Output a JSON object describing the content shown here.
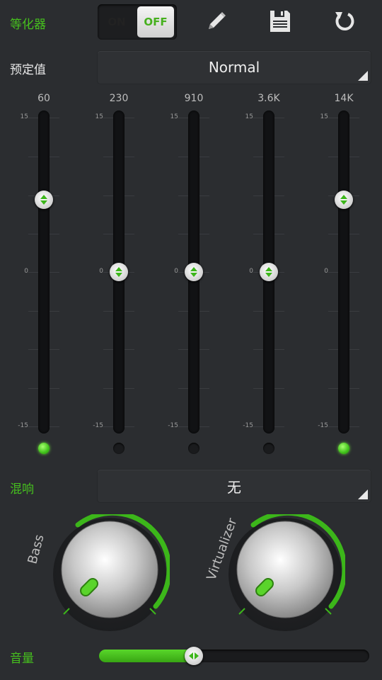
{
  "equalizer": {
    "label": "等化器",
    "toggle": {
      "on_label": "ON",
      "off_label": "OFF",
      "selected": "OFF"
    },
    "icons": [
      "pencil-icon",
      "save-icon",
      "reset-icon"
    ]
  },
  "preset": {
    "label": "预定值",
    "value": "Normal"
  },
  "scale": {
    "max": "15",
    "mid": "0",
    "min": "-15"
  },
  "bands": [
    {
      "freq": "60",
      "level": 7,
      "enabled": true
    },
    {
      "freq": "230",
      "level": 0,
      "enabled": false
    },
    {
      "freq": "910",
      "level": 0,
      "enabled": false
    },
    {
      "freq": "3.6K",
      "level": 0,
      "enabled": false
    },
    {
      "freq": "14K",
      "level": 7,
      "enabled": true
    }
  ],
  "reverb": {
    "label": "混响",
    "value": "无"
  },
  "knobs": {
    "bass_label": "Bass",
    "virtualizer_label": "Virtualizer"
  },
  "volume": {
    "label": "音量",
    "level": 0.35
  },
  "colors": {
    "accent": "#46c01e",
    "background": "#2b2d30"
  }
}
